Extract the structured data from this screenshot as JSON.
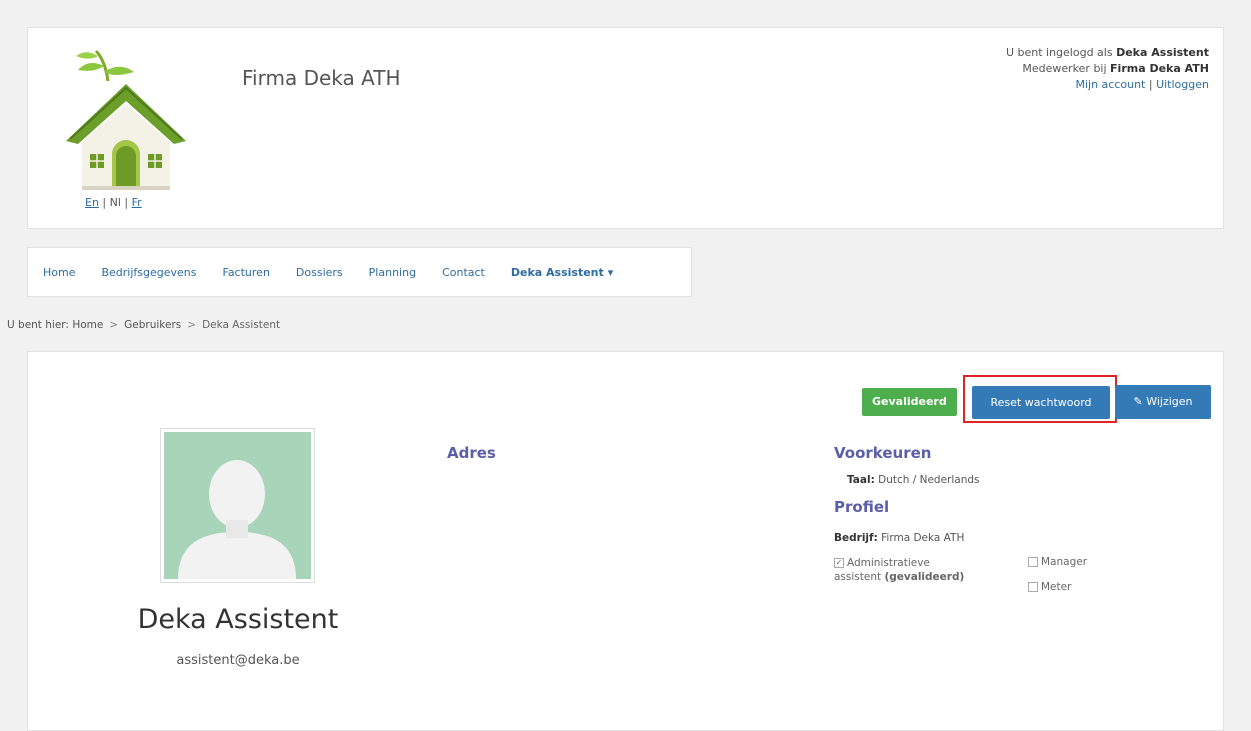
{
  "header": {
    "company_name": "Firma Deka ATH",
    "languages": {
      "en": "En",
      "sep1": " | ",
      "nl": "Nl",
      "sep2": " | ",
      "fr": "Fr"
    },
    "user": {
      "logged_in_prefix": "U bent ingelogd als ",
      "user_name": "Deka Assistent",
      "employee_prefix": "Medewerker bij ",
      "employer": "Firma Deka ATH",
      "my_account": "Mijn account",
      "separator": " | ",
      "logout": "Uitloggen"
    }
  },
  "nav": {
    "items": [
      {
        "label": "Home"
      },
      {
        "label": "Bedrijfsgegevens"
      },
      {
        "label": "Facturen"
      },
      {
        "label": "Dossiers"
      },
      {
        "label": "Planning"
      },
      {
        "label": "Contact"
      },
      {
        "label": "Deka Assistent",
        "dropdown": true
      }
    ]
  },
  "breadcrumb": {
    "prefix": "U bent hier:",
    "items": [
      "Home",
      "Gebruikers",
      "Deka Assistent"
    ],
    "separator": ">"
  },
  "profile": {
    "status_badge": "Gevalideerd",
    "reset_button": "Reset wachtwoord",
    "edit_button": "Wijzigen",
    "name": "Deka Assistent",
    "email": "assistent@deka.be",
    "address_heading": "Adres",
    "preferences_heading": "Voorkeuren",
    "language_label": "Taal:",
    "language_value": " Dutch / Nederlands",
    "profile_heading": "Profiel",
    "company_label": "Bedrijf:",
    "company_value": " Firma Deka ATH",
    "roles": [
      {
        "label": "Administratieve",
        "label2": "assistent",
        "status": "(gevalideerd)",
        "checked": true
      },
      {
        "label": "Manager",
        "checked": false
      },
      {
        "label": "Meter",
        "checked": false
      }
    ]
  },
  "colors": {
    "accent": "#337ab7",
    "link": "#2d6ca2",
    "success": "#4cae4c",
    "heading": "#5b5fa8",
    "highlight": "#e02424"
  }
}
